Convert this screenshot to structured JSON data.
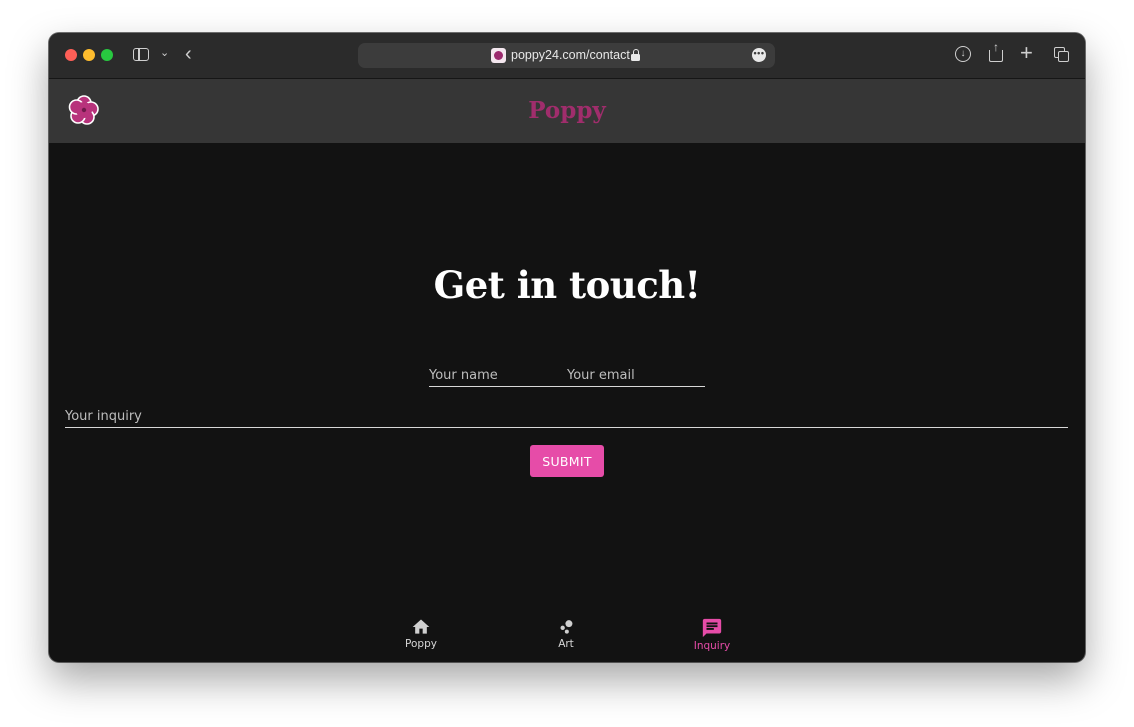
{
  "browser": {
    "url": "poppy24.com/contact"
  },
  "app": {
    "title": "Poppy",
    "brand_color": "#a02d6c",
    "accent_color": "#e64ca8"
  },
  "contact": {
    "heading": "Get in touch!",
    "name_placeholder": "Your name",
    "email_placeholder": "Your email",
    "inquiry_placeholder": "Your inquiry",
    "submit_label": "SUBMIT"
  },
  "bottom_nav": {
    "items": [
      {
        "label": "Poppy",
        "icon": "home-icon",
        "active": false
      },
      {
        "label": "Art",
        "icon": "art-icon",
        "active": false
      },
      {
        "label": "Inquiry",
        "icon": "chat-icon",
        "active": true
      }
    ]
  }
}
